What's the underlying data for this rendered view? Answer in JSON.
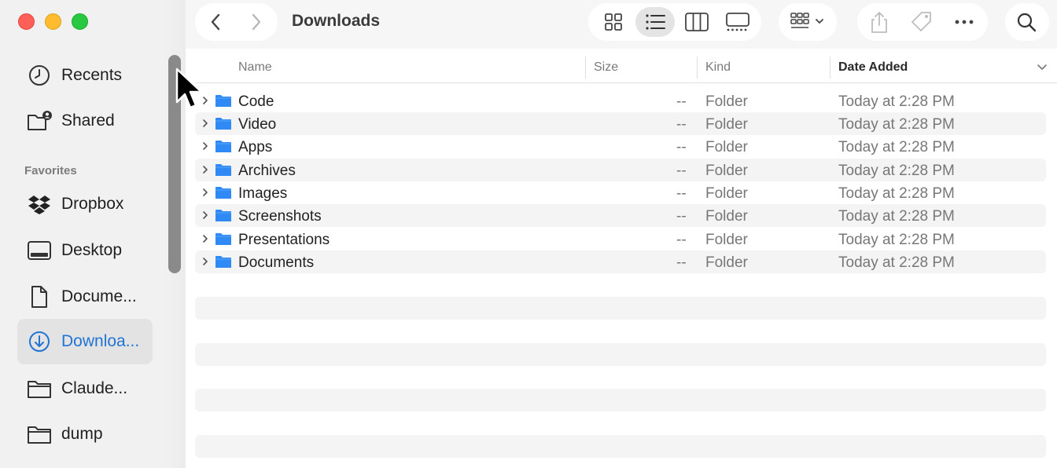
{
  "window": {
    "title": "Downloads"
  },
  "sidebar": {
    "items": [
      {
        "label": "Recents",
        "icon": "clock-icon"
      },
      {
        "label": "Shared",
        "icon": "shared-folder-icon"
      }
    ],
    "favorites_heading": "Favorites",
    "favorites": [
      {
        "label": "Dropbox",
        "icon": "dropbox-icon"
      },
      {
        "label": "Desktop",
        "icon": "desktop-icon"
      },
      {
        "label": "Docume...",
        "icon": "document-icon"
      },
      {
        "label": "Downloa...",
        "icon": "download-icon",
        "selected": true
      },
      {
        "label": "Claude...",
        "icon": "folder-icon"
      },
      {
        "label": "dump",
        "icon": "folder-icon"
      }
    ]
  },
  "toolbar": {
    "views": [
      "icon-view-icon",
      "list-view-icon",
      "column-view-icon",
      "gallery-view-icon"
    ],
    "active_view": "list-view-icon",
    "actions": [
      "group-icon",
      "share-icon",
      "tag-icon",
      "more-icon",
      "search-icon"
    ]
  },
  "columns": {
    "name": "Name",
    "size": "Size",
    "kind": "Kind",
    "date": "Date Added",
    "sorted_by": "Date Added"
  },
  "files": [
    {
      "name": "Code",
      "size": "--",
      "kind": "Folder",
      "date": "Today at 2:28 PM"
    },
    {
      "name": "Video",
      "size": "--",
      "kind": "Folder",
      "date": "Today at 2:28 PM"
    },
    {
      "name": "Apps",
      "size": "--",
      "kind": "Folder",
      "date": "Today at 2:28 PM"
    },
    {
      "name": "Archives",
      "size": "--",
      "kind": "Folder",
      "date": "Today at 2:28 PM"
    },
    {
      "name": "Images",
      "size": "--",
      "kind": "Folder",
      "date": "Today at 2:28 PM"
    },
    {
      "name": "Screenshots",
      "size": "--",
      "kind": "Folder",
      "date": "Today at 2:28 PM"
    },
    {
      "name": "Presentations",
      "size": "--",
      "kind": "Folder",
      "date": "Today at 2:28 PM"
    },
    {
      "name": "Documents",
      "size": "--",
      "kind": "Folder",
      "date": "Today at 2:28 PM"
    }
  ],
  "colors": {
    "accent": "#1f74d6",
    "folder": "#2f8af5",
    "alt_row": "#f4f4f4"
  }
}
